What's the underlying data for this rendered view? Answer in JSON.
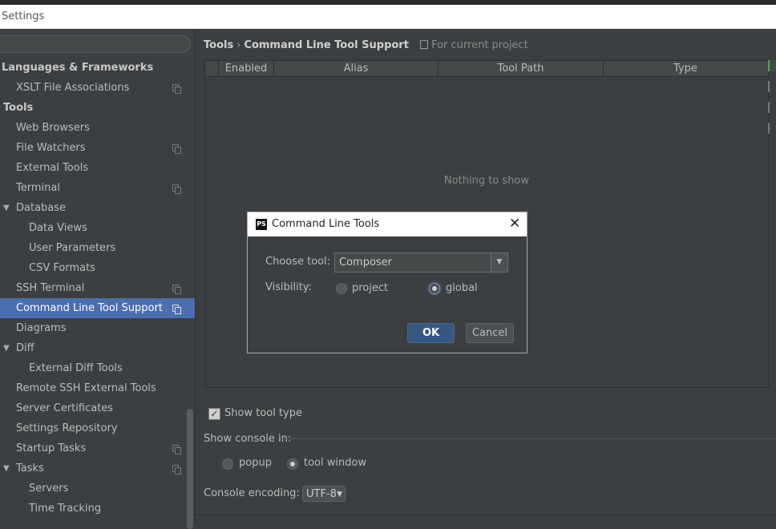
{
  "window": {
    "title": "Settings"
  },
  "sidebar": {
    "search_placeholder": "",
    "items": [
      {
        "label": "Languages & Frameworks",
        "level": 0,
        "bold": true,
        "has_copy_icon": false
      },
      {
        "label": "XSLT File Associations",
        "level": 1,
        "has_copy_icon": true
      },
      {
        "label": "Tools",
        "level": 0,
        "bold": true,
        "has_copy_icon": false
      },
      {
        "label": "Web Browsers",
        "level": 1,
        "has_copy_icon": false
      },
      {
        "label": "File Watchers",
        "level": 1,
        "has_copy_icon": true
      },
      {
        "label": "External Tools",
        "level": 1,
        "has_copy_icon": false
      },
      {
        "label": "Terminal",
        "level": 1,
        "has_copy_icon": true
      },
      {
        "label": "Database",
        "level": 1,
        "expanded": true,
        "has_copy_icon": false
      },
      {
        "label": "Data Views",
        "level": 2,
        "has_copy_icon": false
      },
      {
        "label": "User Parameters",
        "level": 2,
        "has_copy_icon": false
      },
      {
        "label": "CSV Formats",
        "level": 2,
        "has_copy_icon": false
      },
      {
        "label": "SSH Terminal",
        "level": 1,
        "has_copy_icon": true
      },
      {
        "label": "Command Line Tool Support",
        "level": 1,
        "selected": true,
        "has_copy_icon": true
      },
      {
        "label": "Diagrams",
        "level": 1,
        "has_copy_icon": false
      },
      {
        "label": "Diff",
        "level": 1,
        "expanded": true,
        "has_copy_icon": false
      },
      {
        "label": "External Diff Tools",
        "level": 2,
        "has_copy_icon": false
      },
      {
        "label": "Remote SSH External Tools",
        "level": 1,
        "has_copy_icon": false
      },
      {
        "label": "Server Certificates",
        "level": 1,
        "has_copy_icon": false
      },
      {
        "label": "Settings Repository",
        "level": 1,
        "has_copy_icon": false
      },
      {
        "label": "Startup Tasks",
        "level": 1,
        "has_copy_icon": true
      },
      {
        "label": "Tasks",
        "level": 1,
        "expanded": true,
        "has_copy_icon": true
      },
      {
        "label": "Servers",
        "level": 2,
        "has_copy_icon": false
      },
      {
        "label": "Time Tracking",
        "level": 2,
        "has_copy_icon": false
      }
    ]
  },
  "breadcrumb": {
    "parent": "Tools",
    "separator": "›",
    "current": "Command Line Tool Support",
    "scope": "For current project"
  },
  "table": {
    "columns": [
      "Enabled",
      "Alias",
      "Tool Path",
      "Type"
    ],
    "empty_text": "Nothing to show"
  },
  "options": {
    "show_tool_type_label": "Show tool type",
    "show_tool_type_checked": true,
    "show_console_in_label": "Show console in:",
    "console_popup_label": "popup",
    "console_tool_window_label": "tool window",
    "console_selected": "tool window",
    "console_encoding_label": "Console encoding:",
    "console_encoding_value": "UTF-8"
  },
  "dialog": {
    "title": "Command Line Tools",
    "logo_text": "PS",
    "close_glyph": "✕",
    "choose_tool_label": "Choose tool:",
    "choose_tool_value": "Composer",
    "visibility_label": "Visibility:",
    "visibility_project_label": "project",
    "visibility_global_label": "global",
    "visibility_selected": "global",
    "ok_label": "OK",
    "cancel_label": "Cancel"
  },
  "colors": {
    "background": "#3c3f41",
    "selection": "#4b6eaf",
    "ok_button": "#365880"
  }
}
